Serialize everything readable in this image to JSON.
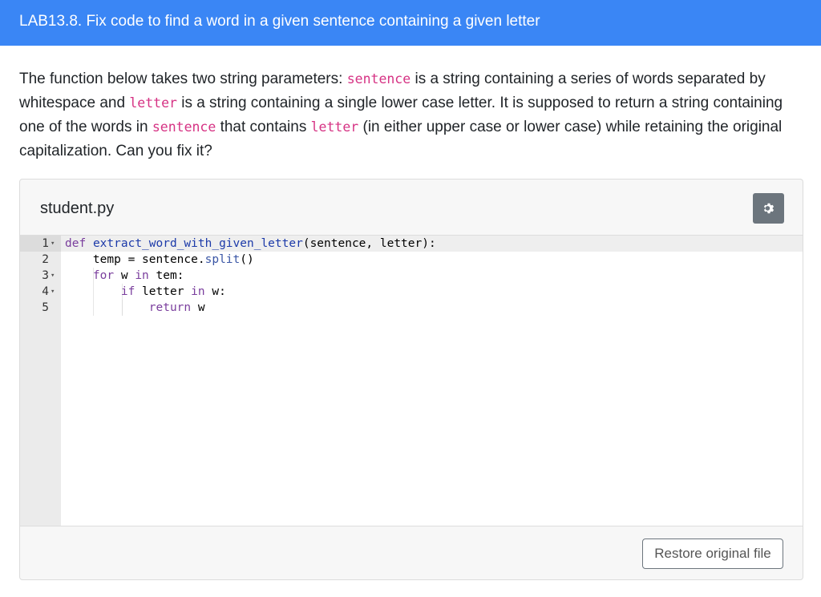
{
  "header": {
    "title": "LAB13.8. Fix code to find a word in a given sentence containing a given letter"
  },
  "description": {
    "part1": "The function below takes two string parameters: ",
    "code1": "sentence",
    "part2": " is a string containing a series of words separated by whitespace and ",
    "code2": "letter",
    "part3": " is a string containing a single lower case letter. It is supposed to return a string containing one of the words in ",
    "code3": "sentence",
    "part4": " that contains ",
    "code4": "letter",
    "part5": " (in either upper case or lower case) while retaining the original capitalization. Can you fix it?"
  },
  "panel": {
    "filename": "student.py",
    "settings_icon": "gear-icon",
    "restore_label": "Restore original file"
  },
  "editor": {
    "lines": [
      {
        "number": "1",
        "fold": "▾",
        "tokens": [
          {
            "t": "def",
            "c": "kw"
          },
          {
            "t": " "
          },
          {
            "t": "extract_word_with_given_letter",
            "c": "fn"
          },
          {
            "t": "(sentence, letter):"
          }
        ]
      },
      {
        "number": "2",
        "fold": "",
        "tokens": [
          {
            "t": "    temp = sentence."
          },
          {
            "t": "split",
            "c": "kw2"
          },
          {
            "t": "()"
          }
        ]
      },
      {
        "number": "3",
        "fold": "▾",
        "tokens": [
          {
            "t": "    "
          },
          {
            "t": "for",
            "c": "kw"
          },
          {
            "t": " w "
          },
          {
            "t": "in",
            "c": "kw"
          },
          {
            "t": " tem:"
          }
        ]
      },
      {
        "number": "4",
        "fold": "▾",
        "tokens": [
          {
            "t": "        "
          },
          {
            "t": "if",
            "c": "kw"
          },
          {
            "t": " letter "
          },
          {
            "t": "in",
            "c": "kw"
          },
          {
            "t": " w:"
          }
        ]
      },
      {
        "number": "5",
        "fold": "",
        "tokens": [
          {
            "t": "            "
          },
          {
            "t": "return",
            "c": "kw"
          },
          {
            "t": " w"
          }
        ]
      }
    ]
  }
}
